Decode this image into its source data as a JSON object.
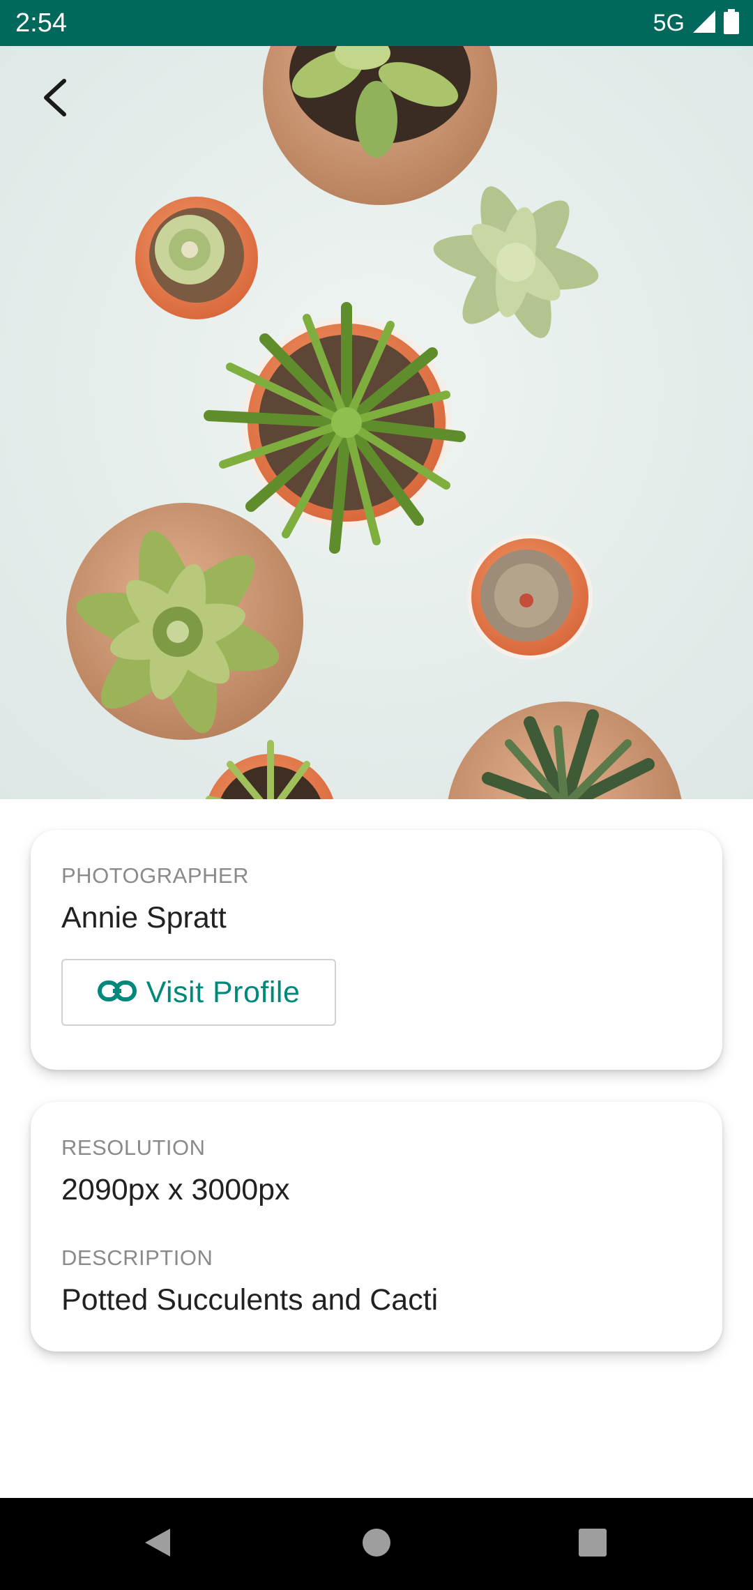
{
  "status_bar": {
    "time": "2:54",
    "network": "5G",
    "icons": [
      "signal-icon",
      "battery-icon"
    ]
  },
  "hero": {
    "alt": "Potted Succulents and Cacti",
    "back_icon": "back-arrow-icon"
  },
  "photographer_card": {
    "label": "PHOTOGRAPHER",
    "name": "Annie Spratt",
    "button_icon": "link-icon",
    "button_label": "Visit Profile"
  },
  "info_card": {
    "resolution_label": "RESOLUTION",
    "resolution_value": "2090px x 3000px",
    "description_label": "DESCRIPTION",
    "description_value": "Potted Succulents and Cacti"
  },
  "nav_bar": {
    "icons": [
      "nav-back-icon",
      "nav-home-icon",
      "nav-recents-icon"
    ]
  },
  "colors": {
    "status_bar": "#00695c",
    "accent": "#00897b",
    "label": "#8a8a8a",
    "text": "#212121",
    "nav_bar": "#000000"
  }
}
